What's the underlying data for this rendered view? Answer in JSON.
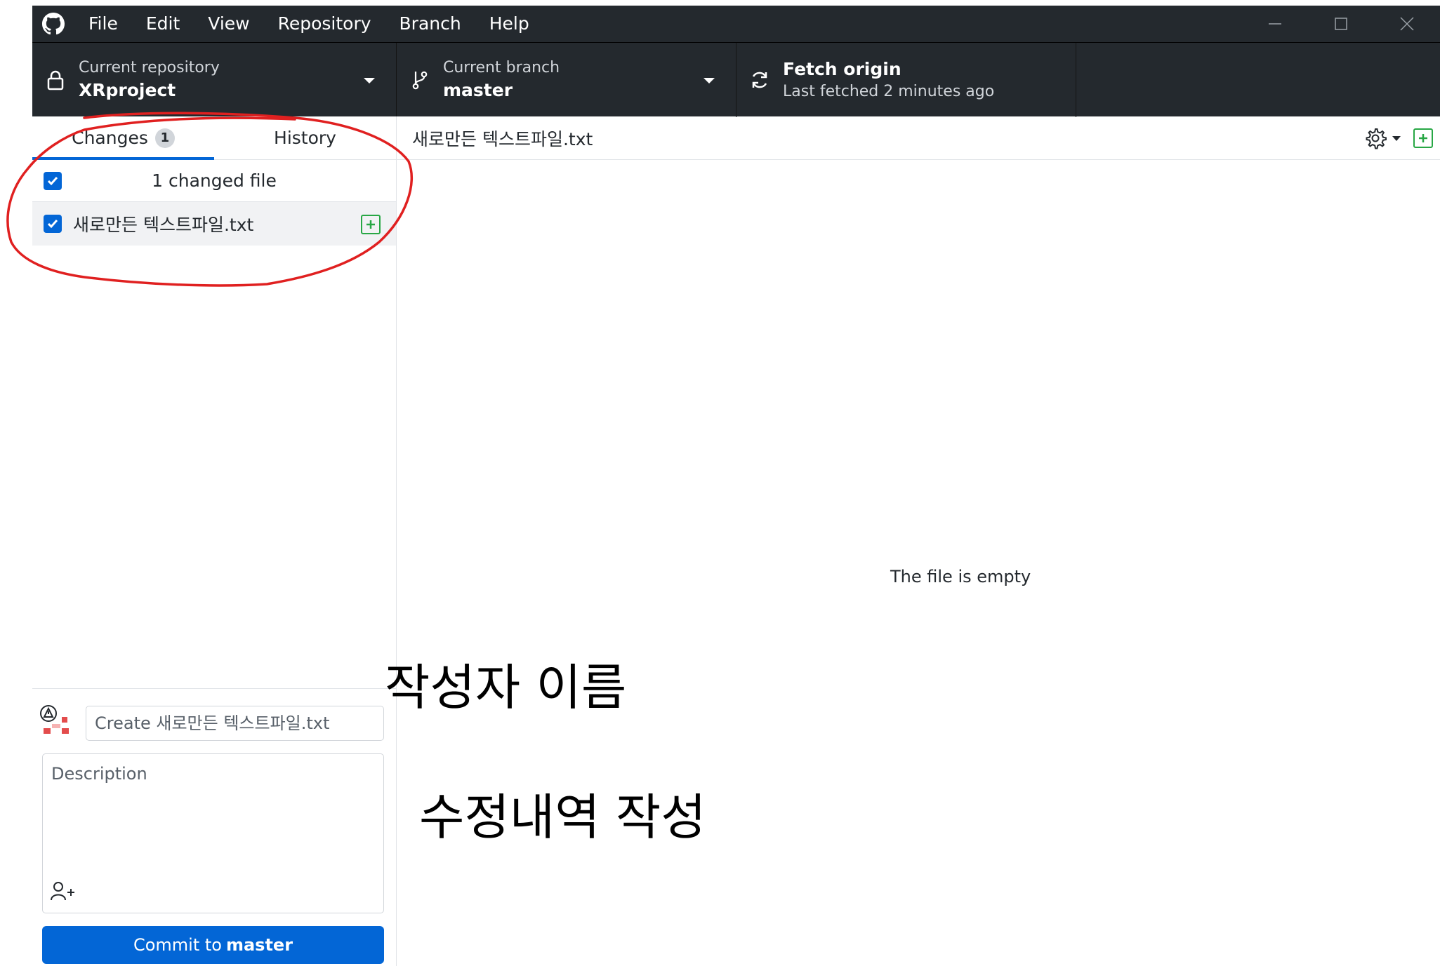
{
  "menu": [
    "File",
    "Edit",
    "View",
    "Repository",
    "Branch",
    "Help"
  ],
  "toolbar": {
    "repo_caption": "Current repository",
    "repo_name": "XRproject",
    "branch_caption": "Current branch",
    "branch_name": "master",
    "fetch_title": "Fetch origin",
    "fetch_status": "Last fetched 2 minutes ago"
  },
  "tabs": {
    "changes_label": "Changes",
    "changes_count": "1",
    "history_label": "History"
  },
  "changes": {
    "header": "1 changed file",
    "files": [
      {
        "name": "새로만든 텍스트파일.txt",
        "status": "added"
      }
    ]
  },
  "diff": {
    "path": "새로만든 텍스트파일.txt",
    "empty_message": "The file is empty"
  },
  "commit": {
    "summary_placeholder": "Create 새로만든 텍스트파일.txt",
    "description_placeholder": "Description",
    "button_prefix": "Commit to",
    "button_branch": "master"
  },
  "annotations": {
    "author_note": "작성자 이름",
    "description_note": "수정내역 작성",
    "highlight_color": "#e02020"
  },
  "colors": {
    "toolbar_bg": "#24292e",
    "accent_blue": "#0366d6",
    "added_green": "#28a745"
  }
}
